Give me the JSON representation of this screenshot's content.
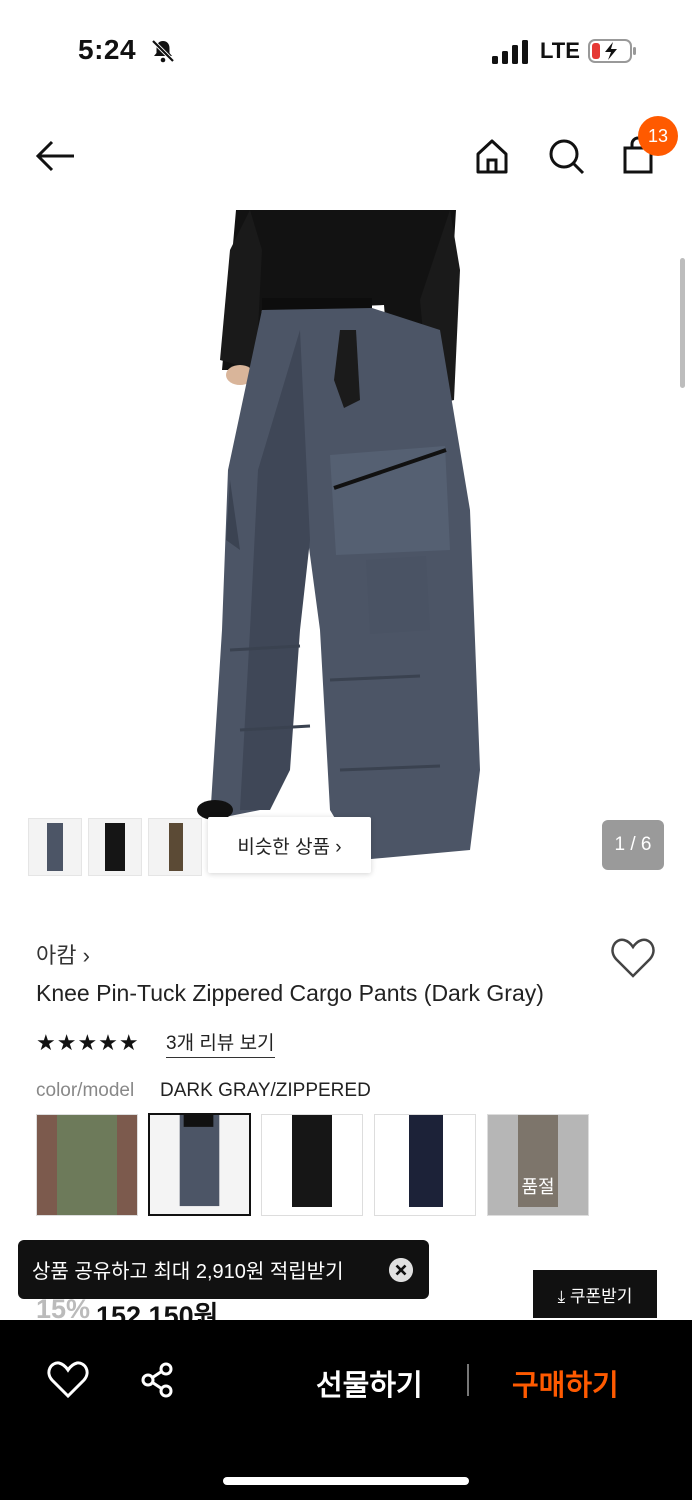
{
  "status_bar": {
    "time": "5:24",
    "network": "LTE"
  },
  "header": {
    "cart_count": "13"
  },
  "gallery": {
    "similar_label": "비슷한 상품 ›",
    "counter": "1 / 6"
  },
  "product": {
    "brand": "아캄 ›",
    "title": "Knee Pin-Tuck Zippered Cargo Pants (Dark Gray)",
    "stars": "★★★★★",
    "reviews_link": "3개 리뷰 보기",
    "option_label": "color/model",
    "option_value": "DARK GRAY/ZIPPERED",
    "soldout_label": "품절",
    "discount": "15%",
    "price": "152,150원"
  },
  "toast": {
    "text": "상품 공유하고 최대 2,910원 적립받기"
  },
  "coupon": {
    "label": "⤓ 쿠폰받기"
  },
  "bottom": {
    "gift_label": "선물하기",
    "buy_label": "구매하기"
  },
  "colors": {
    "accent": "#ff5a00",
    "bar": "#000000"
  }
}
